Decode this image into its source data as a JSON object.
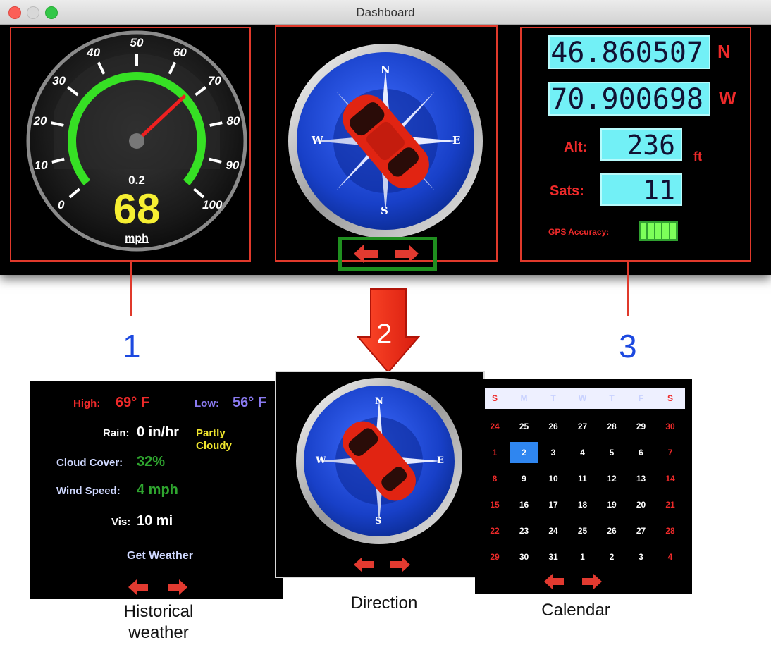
{
  "window": {
    "title": "Dashboard"
  },
  "speedometer": {
    "ticks": [
      "0",
      "10",
      "20",
      "30",
      "40",
      "50",
      "60",
      "70",
      "80",
      "90",
      "100"
    ],
    "trip": "0.2",
    "speed": "68",
    "unit": "mph",
    "speed_value_mph": 68
  },
  "gps": {
    "latitude": "46.860507",
    "lat_dir": "N",
    "longitude": "70.900698",
    "lon_dir": "W",
    "alt_label": "Alt:",
    "alt_value": "236",
    "alt_unit": "ft",
    "sats_label": "Sats:",
    "sats_value": "11",
    "accuracy_label": "GPS Accuracy:",
    "accuracy_bars": 5
  },
  "compass": {
    "north": "N",
    "south": "S",
    "east": "E",
    "west": "W"
  },
  "callouts": {
    "one": "1",
    "two": "2",
    "three": "3"
  },
  "weather": {
    "high_label": "High:",
    "high_value": "69° F",
    "low_label": "Low:",
    "low_value": "56° F",
    "rain_label": "Rain:",
    "rain_value": "0 in/hr",
    "condition_line1": "Partly",
    "condition_line2": "Cloudy",
    "cloud_label": "Cloud Cover:",
    "cloud_value": "32%",
    "wind_label": "Wind Speed:",
    "wind_value": "4 mph",
    "vis_label": "Vis:",
    "vis_value": "10 mi",
    "get_weather": "Get Weather"
  },
  "calendar": {
    "weekdays": [
      "S",
      "M",
      "T",
      "W",
      "T",
      "F",
      "S"
    ],
    "weeks": [
      [
        "24",
        "25",
        "26",
        "27",
        "28",
        "29",
        "30"
      ],
      [
        "1",
        "2",
        "3",
        "4",
        "5",
        "6",
        "7"
      ],
      [
        "8",
        "9",
        "10",
        "11",
        "12",
        "13",
        "14"
      ],
      [
        "15",
        "16",
        "17",
        "18",
        "19",
        "20",
        "21"
      ],
      [
        "22",
        "23",
        "24",
        "25",
        "26",
        "27",
        "28"
      ],
      [
        "29",
        "30",
        "31",
        "1",
        "2",
        "3",
        "4"
      ]
    ],
    "selected": "2"
  },
  "captions": {
    "weather_line1": "Historical",
    "weather_line2": "weather",
    "direction": "Direction",
    "calendar": "Calendar"
  },
  "colors": {
    "panel_border": "#e0392b",
    "lcd": "#72f0f6",
    "accent_red": "#ee2a2a",
    "gauge_green": "#36e024",
    "highlight_green": "#1f8f1f",
    "callout_blue": "#1c49e0"
  }
}
